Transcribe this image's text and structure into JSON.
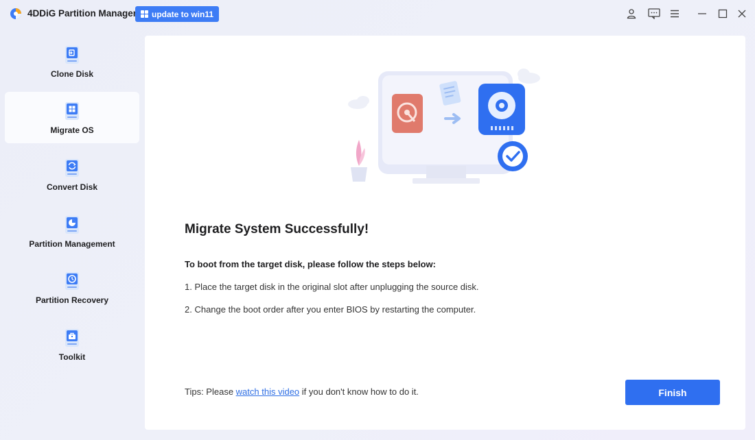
{
  "app": {
    "title": "4DDiG Partition Manager",
    "update_label": "update to win11"
  },
  "window_controls": [
    "user-icon",
    "feedback-icon",
    "menu-icon",
    "minimize-icon",
    "maximize-icon",
    "close-icon"
  ],
  "sidebar": {
    "items": [
      {
        "label": "Clone Disk",
        "icon": "clone-disk-icon"
      },
      {
        "label": "Migrate OS",
        "icon": "migrate-os-icon",
        "active": true
      },
      {
        "label": "Convert Disk",
        "icon": "convert-disk-icon"
      },
      {
        "label": "Partition Management",
        "icon": "partition-management-icon"
      },
      {
        "label": "Partition Recovery",
        "icon": "partition-recovery-icon"
      },
      {
        "label": "Toolkit",
        "icon": "toolkit-icon"
      }
    ]
  },
  "main": {
    "heading": "Migrate System Successfully!",
    "steps_title": "To boot from the target disk, please follow the steps below:",
    "steps": [
      "1. Place the target disk in the original slot after unplugging the source disk.",
      "2. Change the boot order after you enter BIOS by restarting the computer."
    ],
    "tips_prefix": "Tips: Please ",
    "tips_link": "watch this video",
    "tips_suffix": " if you don't know how to do it.",
    "finish_label": "Finish"
  },
  "colors": {
    "accent": "#2f6ff0",
    "update_button": "#3d7cf5",
    "link": "#2f6fe4"
  }
}
